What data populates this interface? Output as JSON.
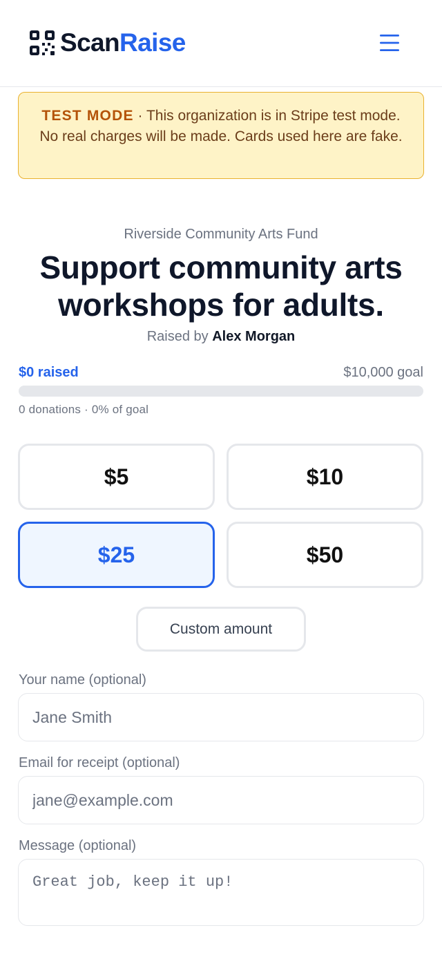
{
  "brand": {
    "name_part1": "Scan",
    "name_part2": "Raise",
    "accent_color": "#2563eb",
    "logo_icon": "qr-code-icon"
  },
  "header": {
    "menu_icon": "hamburger-menu-icon"
  },
  "banner": {
    "tag": "TEST MODE",
    "separator": " · ",
    "message": "This organization is in Stripe test mode. No real charges will be made. Cards used here are fake.",
    "background_color": "#fef3c7"
  },
  "campaign": {
    "organization": "Riverside Community Arts Fund",
    "title": "Support community arts workshops for adults.",
    "raised_by_prefix": "Raised by",
    "raised_by_name": "Alex Morgan"
  },
  "progress": {
    "raised_label": "$0 raised",
    "goal_label": "$10,000 goal",
    "stats": "0 donations · 0% of goal",
    "fraction": 0
  },
  "amounts": [
    {
      "label": "$5",
      "selected": false
    },
    {
      "label": "$10",
      "selected": false
    },
    {
      "label": "$25",
      "selected": true
    },
    {
      "label": "$50",
      "selected": false
    }
  ],
  "custom_amount_label": "Custom amount",
  "form": {
    "name_label": "Your name (optional)",
    "name_placeholder": "Jane Smith",
    "email_label": "Email for receipt (optional)",
    "email_placeholder": "jane@example.com",
    "message_label": "Message (optional)",
    "message_placeholder": "Great job, keep it up!"
  }
}
